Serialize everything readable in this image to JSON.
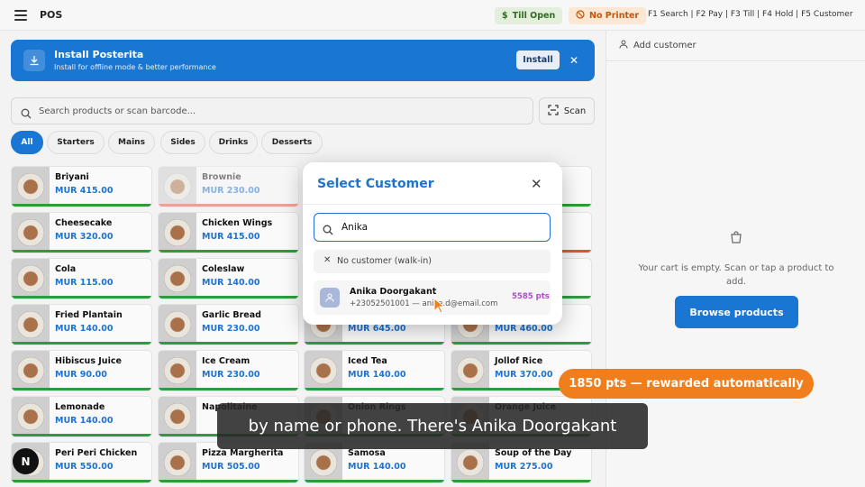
{
  "topbar": {
    "title": "POS",
    "till_status": "Till Open",
    "printer_status": "No Printer",
    "shortcuts": "F1 Search | F2 Pay | F3 Till | F4 Hold | F5 Customer"
  },
  "banner": {
    "title": "Install Posterita",
    "subtitle": "Install for offline mode & better performance",
    "install_label": "Install"
  },
  "search": {
    "placeholder": "Search products or scan barcode...",
    "scan_label": "Scan"
  },
  "categories": [
    "All",
    "Starters",
    "Mains",
    "Sides",
    "Drinks",
    "Desserts"
  ],
  "active_category": "All",
  "products": [
    {
      "name": "Briyani",
      "price": "MUR 415.00"
    },
    {
      "name": "Brownie",
      "price": "MUR 230.00"
    },
    {
      "name": "",
      "price": ""
    },
    {
      "name": "",
      "price": ""
    },
    {
      "name": "Cheesecake",
      "price": "MUR 320.00"
    },
    {
      "name": "Chicken Wings",
      "price": "MUR 415.00"
    },
    {
      "name": "",
      "price": ""
    },
    {
      "name": "",
      "price": ""
    },
    {
      "name": "Cola",
      "price": "MUR 115.00"
    },
    {
      "name": "Coleslaw",
      "price": "MUR 140.00"
    },
    {
      "name": "",
      "price": ""
    },
    {
      "name": "",
      "price": ""
    },
    {
      "name": "Fried Plantain",
      "price": "MUR 140.00"
    },
    {
      "name": "Garlic Bread",
      "price": "MUR 230.00"
    },
    {
      "name": "",
      "price": "MUR 645.00"
    },
    {
      "name": "",
      "price": "MUR 460.00"
    },
    {
      "name": "Hibiscus Juice",
      "price": "MUR 90.00"
    },
    {
      "name": "Ice Cream",
      "price": "MUR 230.00"
    },
    {
      "name": "Iced Tea",
      "price": "MUR 140.00"
    },
    {
      "name": "Jollof Rice",
      "price": "MUR 370.00"
    },
    {
      "name": "Lemonade",
      "price": "MUR 140.00"
    },
    {
      "name": "Napolitaine",
      "price": ""
    },
    {
      "name": "Onion Rings",
      "price": ""
    },
    {
      "name": "Orange Juice",
      "price": ""
    },
    {
      "name": "Peri Peri Chicken",
      "price": "MUR 550.00"
    },
    {
      "name": "Pizza Margherita",
      "price": "MUR 505.00"
    },
    {
      "name": "Samosa",
      "price": "MUR 140.00"
    },
    {
      "name": "Soup of the Day",
      "price": "MUR 275.00"
    }
  ],
  "cart": {
    "add_customer_label": "Add customer",
    "empty_text": "Your cart is empty. Scan or tap a product to add.",
    "browse_label": "Browse products"
  },
  "modal": {
    "title": "Select Customer",
    "search_value": "Anika",
    "walkin_label": "No customer (walk-in)",
    "customer": {
      "name": "Anika Doorgakant",
      "contact": "+23052501001 — anika.d@email.com",
      "points": "5585 pts"
    }
  },
  "overlay": {
    "reward_badge": "1850 pts — rewarded automatically",
    "caption": "by name or phone. There's Anika Doorgakant",
    "next_badge": "N"
  },
  "colors": {
    "accent": "#1976d2",
    "price": "#1e73cf",
    "stock_ok": "#2e9b3c",
    "points": "#b04ad0",
    "reward": "#f07e1c"
  }
}
